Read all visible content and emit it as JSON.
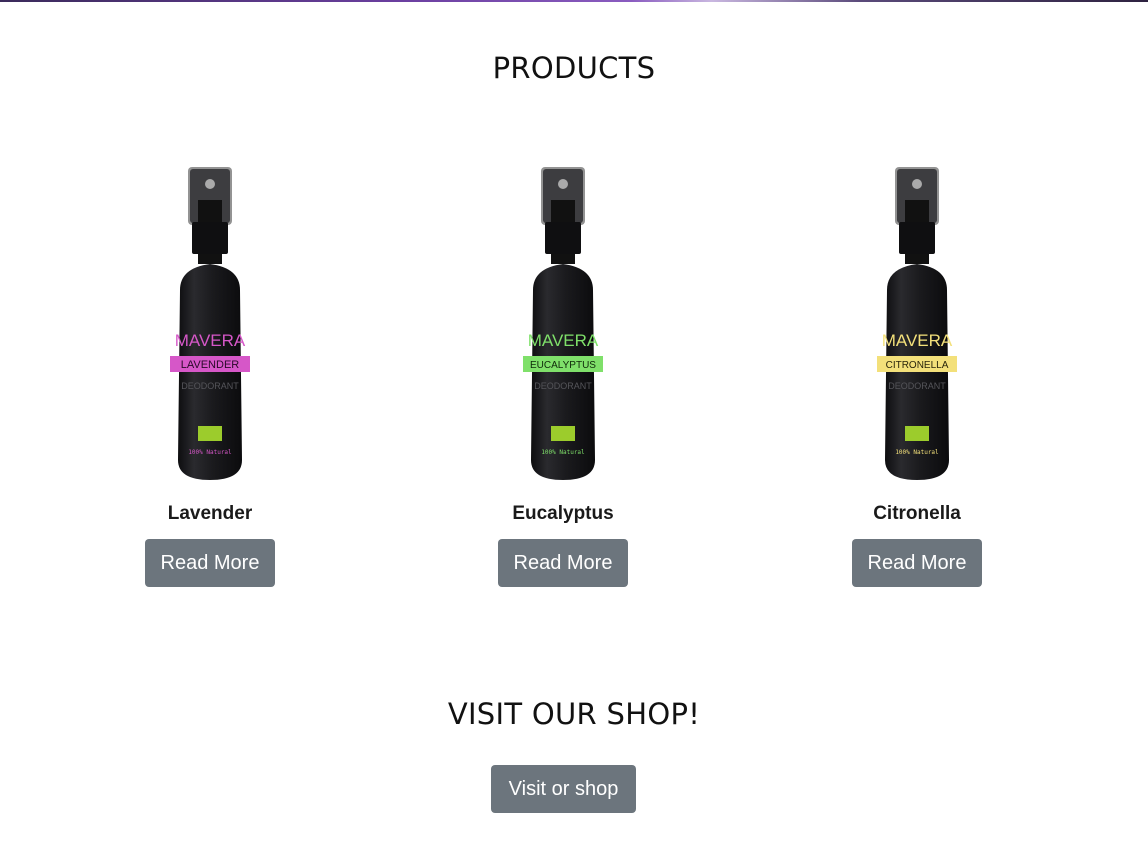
{
  "products_section": {
    "title": "PRODUCTS",
    "items": [
      {
        "name": "Lavender",
        "button_label": "Read More",
        "label_brand": "MAVERA",
        "label_variant": "LAVENDER",
        "label_type": "DEODORANT",
        "label_claim": "100% Natural",
        "accent_color": "#d657c8"
      },
      {
        "name": "Eucalyptus",
        "button_label": "Read More",
        "label_brand": "MAVERA",
        "label_variant": "EUCALYPTUS",
        "label_type": "DEODORANT",
        "label_claim": "100% Natural",
        "accent_color": "#7fe06a"
      },
      {
        "name": "Citronella",
        "button_label": "Read More",
        "label_brand": "MAVERA",
        "label_variant": "CITRONELLA",
        "label_type": "DEODORANT",
        "label_claim": "100% Natural",
        "accent_color": "#f3e07a"
      }
    ]
  },
  "shop_section": {
    "title": "VISIT OUR SHOP!",
    "button_label": "Visit or shop"
  },
  "colors": {
    "button_bg": "#6c757d",
    "button_text": "#ffffff",
    "bottle_body": "#1c1c1e",
    "eu_organic_leaf": "#9ccc2c"
  }
}
